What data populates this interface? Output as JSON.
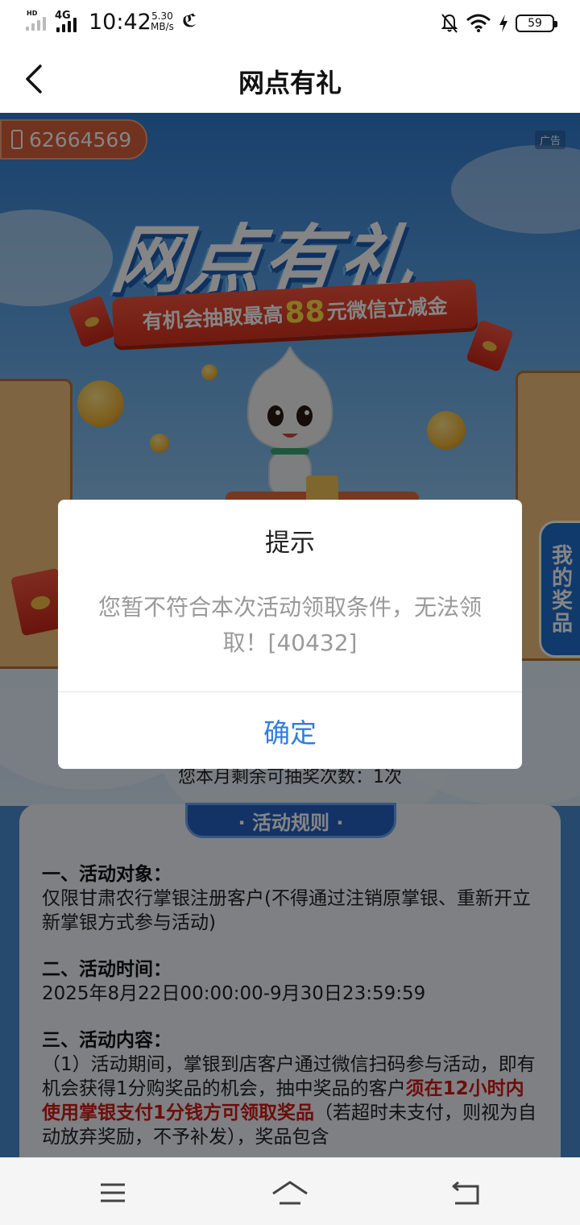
{
  "status_bar": {
    "time": "10:42",
    "network": "4G",
    "hd_label": "HD",
    "speed_value": "5.30",
    "speed_unit": "MB/s",
    "battery": "59",
    "icons": [
      "signal-icon",
      "carrier-icon",
      "mute-bell-icon",
      "wifi-icon",
      "charging-icon",
      "battery-icon"
    ]
  },
  "nav": {
    "title": "网点有礼",
    "back_icon": "back-chevron-icon"
  },
  "banner": {
    "phone": "62664569",
    "ad_label": "广告",
    "title": "网点有礼",
    "subtitle_pre": "有机会抽取最高",
    "subtitle_amount": "88",
    "subtitle_post": "元微信立减金",
    "my_prize": "我的奖品"
  },
  "remaining": "您本月剩余可抽奖次数：1次",
  "rules": {
    "tab": "· 活动规则 ·",
    "sections": [
      {
        "heading": "一、活动对象：",
        "text": "仅限甘肃农行掌银注册客户(不得通过注销原掌银、重新开立新掌银方式参与活动)"
      },
      {
        "heading": "二、活动时间：",
        "text": "2025年8月22日00:00:00-9月30日23:59:59"
      },
      {
        "heading": "三、活动内容：",
        "text_pre": "（1）活动期间，掌银到店客户通过微信扫码参与活动，即有机会获得1分购奖品的机会，抽中奖品的客户",
        "text_red": "须在12小时内使用掌银支付1分钱方可领取奖品",
        "text_post": "（若超时未支付，则视为自动放弃奖励，不予补发），奖品包含"
      }
    ]
  },
  "dialog": {
    "title": "提示",
    "message": "您暂不符合本次活动领取条件，无法领取！[40432]",
    "confirm": "确定"
  },
  "system_nav": {
    "icons": [
      "menu-icon",
      "home-icon",
      "back-icon"
    ]
  },
  "colors": {
    "accent": "#2f7de1",
    "nav_bg": "#ffffff",
    "rules_tab": "#2563c4",
    "highlight_red": "#d11a14"
  }
}
